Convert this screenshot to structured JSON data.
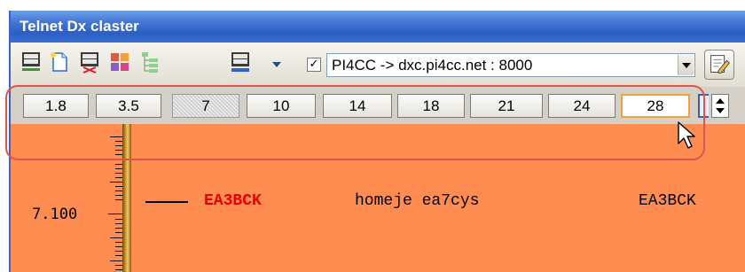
{
  "window": {
    "title": "Telnet Dx claster"
  },
  "toolbar": {
    "icons": [
      "telnet-connect-icon",
      "new-document-icon",
      "telnet-disconnect-icon",
      "filter-icon",
      "tree-icon",
      "telnet-settings-icon",
      "dropdown-arrow-icon"
    ],
    "auto_connect_checked": true,
    "server_select": "PI4CC -> dxc.pi4cc.net : 8000",
    "edit_icon": "edit-notepad-icon"
  },
  "bands": {
    "items": [
      "1.8",
      "3.5",
      "7",
      "10",
      "14",
      "18",
      "21",
      "24",
      "28"
    ],
    "selected": "7",
    "hovered": "28"
  },
  "spectrum": {
    "frequency_label": "7.100",
    "spot": {
      "callsign": "EA3BCK",
      "comment": "homeje ea7cys",
      "spotter": "EA3BCK"
    }
  },
  "colors": {
    "spectrum_bg": "#ff8c50",
    "callsign": "#e60000",
    "highlight": "#e0554a",
    "titlebar": "#2c5fc4"
  }
}
